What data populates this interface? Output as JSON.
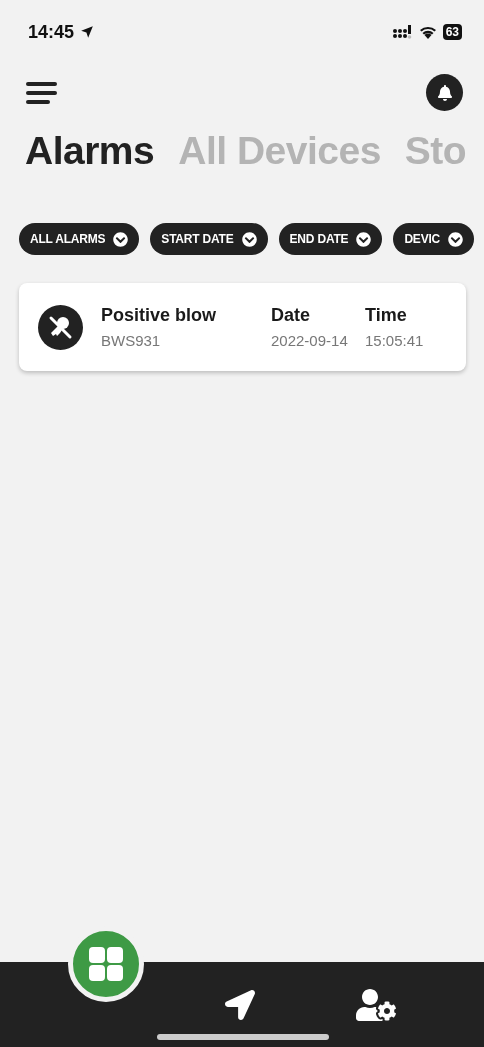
{
  "status_bar": {
    "time": "14:45",
    "battery": "63"
  },
  "tabs": [
    {
      "label": "Alarms",
      "selected": true
    },
    {
      "label": "All Devices",
      "selected": false
    },
    {
      "label": "Sto",
      "selected": false
    }
  ],
  "filters": [
    "ALL ALARMS",
    "START DATE",
    "END DATE",
    "DEVIC"
  ],
  "alarms": [
    {
      "title": "Positive blow",
      "device": "BWS931",
      "date_label": "Date",
      "date": "2022-09-14",
      "time_label": "Time",
      "time": "15:05:41"
    }
  ],
  "bottom_nav": [
    {
      "kind": "dashboard",
      "selected": true
    },
    {
      "kind": "navigate",
      "selected": false
    },
    {
      "kind": "user-settings",
      "selected": false
    }
  ]
}
